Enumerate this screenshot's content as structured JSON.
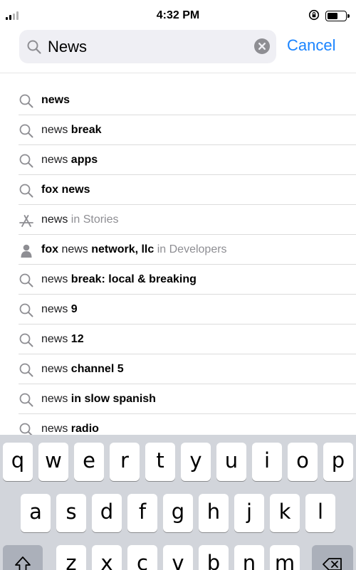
{
  "status_bar": {
    "time": "4:32 PM",
    "battery_level": 0.6,
    "signal_bars_active": 2,
    "signal_bars_total": 4
  },
  "search": {
    "value": "News",
    "cancel_label": "Cancel",
    "icon": "search-icon",
    "clear_icon": "clear-icon"
  },
  "suggestions": [
    {
      "icon": "search-icon",
      "parts": [
        {
          "text": "news",
          "style": "bold"
        }
      ]
    },
    {
      "icon": "search-icon",
      "parts": [
        {
          "text": "news ",
          "style": "normal"
        },
        {
          "text": "break",
          "style": "bold"
        }
      ]
    },
    {
      "icon": "search-icon",
      "parts": [
        {
          "text": "news ",
          "style": "normal"
        },
        {
          "text": "apps",
          "style": "bold"
        }
      ]
    },
    {
      "icon": "search-icon",
      "parts": [
        {
          "text": "fox news",
          "style": "bold"
        }
      ]
    },
    {
      "icon": "app-store-icon",
      "parts": [
        {
          "text": "news",
          "style": "normal"
        },
        {
          "text": " in Stories",
          "style": "muted"
        }
      ]
    },
    {
      "icon": "developer-icon",
      "parts": [
        {
          "text": "fox ",
          "style": "bold"
        },
        {
          "text": "news ",
          "style": "normal"
        },
        {
          "text": "network, llc",
          "style": "bold"
        },
        {
          "text": " in Developers",
          "style": "muted"
        }
      ]
    },
    {
      "icon": "search-icon",
      "parts": [
        {
          "text": "news ",
          "style": "normal"
        },
        {
          "text": "break: local & breaking",
          "style": "bold"
        }
      ]
    },
    {
      "icon": "search-icon",
      "parts": [
        {
          "text": "news ",
          "style": "normal"
        },
        {
          "text": "9",
          "style": "bold"
        }
      ]
    },
    {
      "icon": "search-icon",
      "parts": [
        {
          "text": "news ",
          "style": "normal"
        },
        {
          "text": "12",
          "style": "bold"
        }
      ]
    },
    {
      "icon": "search-icon",
      "parts": [
        {
          "text": "news ",
          "style": "normal"
        },
        {
          "text": "channel 5",
          "style": "bold"
        }
      ]
    },
    {
      "icon": "search-icon",
      "parts": [
        {
          "text": "news ",
          "style": "normal"
        },
        {
          "text": "in slow spanish",
          "style": "bold"
        }
      ]
    },
    {
      "icon": "search-icon",
      "parts": [
        {
          "text": "news ",
          "style": "normal"
        },
        {
          "text": "radio",
          "style": "bold"
        }
      ]
    }
  ],
  "keyboard": {
    "row1": [
      "q",
      "w",
      "e",
      "r",
      "t",
      "y",
      "u",
      "i",
      "o",
      "p"
    ],
    "row2": [
      "a",
      "s",
      "d",
      "f",
      "g",
      "h",
      "j",
      "k",
      "l"
    ],
    "row3": [
      "z",
      "x",
      "c",
      "v",
      "b",
      "n",
      "m"
    ],
    "shift_icon": "shift-icon",
    "delete_icon": "delete-icon"
  },
  "colors": {
    "accent": "#1a84ff",
    "muted_text": "#8e8e93",
    "keyboard_bg": "#d2d5db"
  }
}
